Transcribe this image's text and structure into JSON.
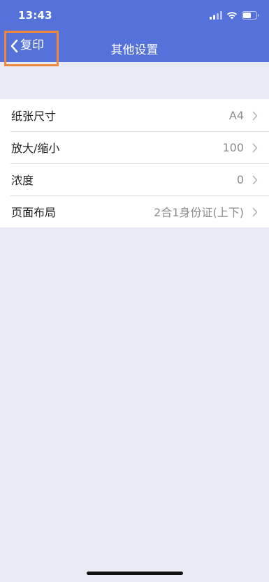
{
  "status_bar": {
    "time": "13:43",
    "icons": [
      "signal-icon",
      "wifi-icon",
      "battery-icon"
    ]
  },
  "navbar": {
    "back_label": "复印",
    "title": "其他设置",
    "back_icon": "chevron-left-icon"
  },
  "settings": {
    "rows": [
      {
        "label": "纸张尺寸",
        "value": "A4"
      },
      {
        "label": "放大/缩小",
        "value": "100"
      },
      {
        "label": "浓度",
        "value": "0"
      },
      {
        "label": "页面布局",
        "value": "2合1身份证(上下)"
      }
    ]
  },
  "colors": {
    "header": "#5472da",
    "background": "#e9eaf3",
    "highlight_border": "#f0873f",
    "value_text": "#8a8a8f"
  }
}
